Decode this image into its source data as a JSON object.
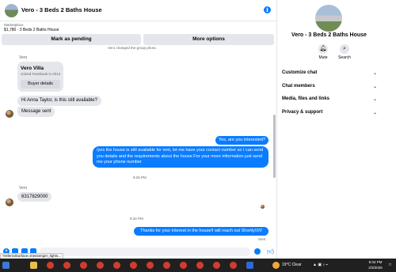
{
  "header": {
    "title": "Vero - 3 Beds 2 Baths House",
    "info_icon": "info-icon"
  },
  "listing": {
    "label": "Marketplace",
    "price_title": "$1,780 · 3 Beds 2 Baths House"
  },
  "actions": {
    "pending": "Mark as pending",
    "more": "More options"
  },
  "thread": {
    "system_note": "Vero changed the group photo.",
    "sender_name": "Vero",
    "card": {
      "name": "Vero Villa",
      "joined": "Joined Facebook in 2012",
      "button": "Buyer details"
    },
    "messages": [
      {
        "id": "m1",
        "dir": "in",
        "text": "Hi Anna Taylor, is this still available?"
      },
      {
        "id": "m2",
        "dir": "in",
        "text": "Message sent"
      },
      {
        "id": "m3",
        "dir": "out",
        "text": "Yes, are you interested?"
      },
      {
        "id": "m4",
        "dir": "out",
        "text": "/yes the house is still available for rent, let me have your contact number so I can send you details and the requirements about the house For your more information just send me your phone number"
      },
      {
        "id": "m5",
        "dir": "in",
        "text": "6317829000"
      },
      {
        "id": "m6",
        "dir": "out",
        "text": "Thanks for your interest in the house!I will reach out Shortly!/////"
      }
    ],
    "time1": "9:26 PM",
    "sender_name_2": "Vero",
    "time2": "9:34 PM",
    "seen": "Sent"
  },
  "composer": {
    "status_url": "?referralSurface=messenger_lights..."
  },
  "panel": {
    "title": "Vero - 3 Beds 2 Baths House",
    "mute": "Mute",
    "search": "Search",
    "sections": [
      "Customize chat",
      "Chat members",
      "Media, files and links",
      "Privacy & support"
    ]
  },
  "taskbar": {
    "weather": "19°C  Clear",
    "time": "9:34 PM",
    "date": "2/3/2025"
  },
  "colors": {
    "accent": "#0a7cff",
    "bubble_in": "#e4e6eb",
    "taskbar": "#202020"
  }
}
